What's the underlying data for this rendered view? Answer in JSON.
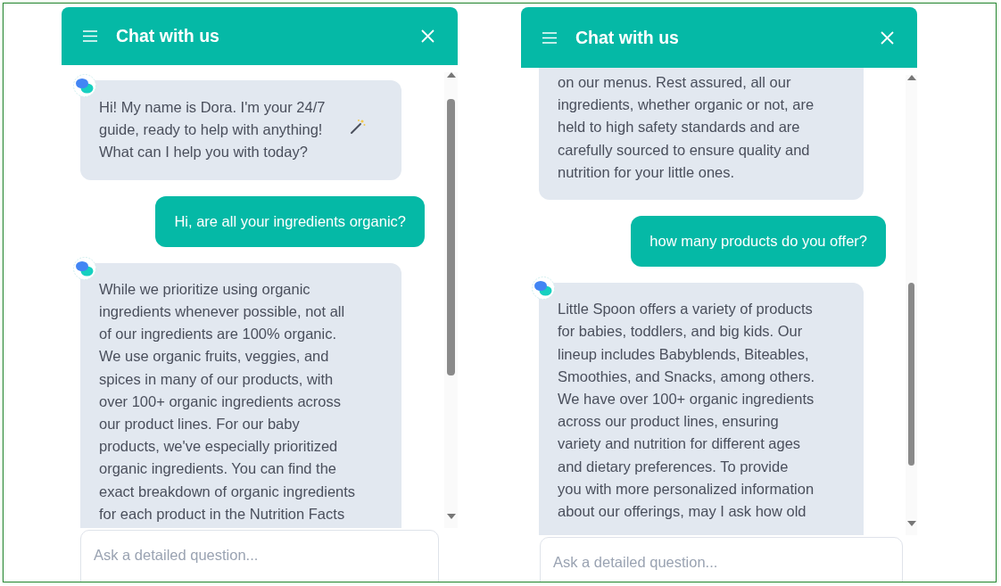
{
  "panels": [
    {
      "title": "Chat with us",
      "messages": [
        {
          "kind": "bot",
          "text": "Hi! My name is Dora. I'm your 24/7\nguide, ready to help with anything!\nWhat can I help you with today?"
        },
        {
          "kind": "user",
          "text": "Hi, are all your ingredients organic?"
        },
        {
          "kind": "bot",
          "text": "While we prioritize using organic\ningredients whenever possible, not all\nof our ingredients are 100% organic.\nWe use organic fruits, veggies, and\nspices in many of our products, with\nover 100+ organic ingredients across\nour product lines. For our baby\nproducts, we've especially prioritized\norganic ingredients. You can find the\nexact breakdown of organic ingredients\nfor each product in the Nutrition Facts"
        }
      ],
      "input": {
        "placeholder": "Ask a detailed question..."
      }
    },
    {
      "title": "Chat with us",
      "messages": [
        {
          "kind": "bot",
          "text": "on our menus. Rest assured, all our\ningredients, whether organic or not, are\nheld to high safety standards and are\ncarefully sourced to ensure quality and\nnutrition for your little ones."
        },
        {
          "kind": "user",
          "text": "how many products do you offer?"
        },
        {
          "kind": "bot",
          "text": "Little Spoon offers a variety of products\nfor babies, toddlers, and big kids. Our\nlineup includes Babyblends, Biteables,\nSmoothies, and Snacks, among others.\nWe have over 100+ organic ingredients\nacross our product lines, ensuring\nvariety and nutrition for different ages\nand dietary preferences. To provide\nyou with more personalized information\nabout our offerings, may I ask how old"
        }
      ],
      "input": {
        "placeholder": "Ask a detailed question..."
      }
    }
  ]
}
